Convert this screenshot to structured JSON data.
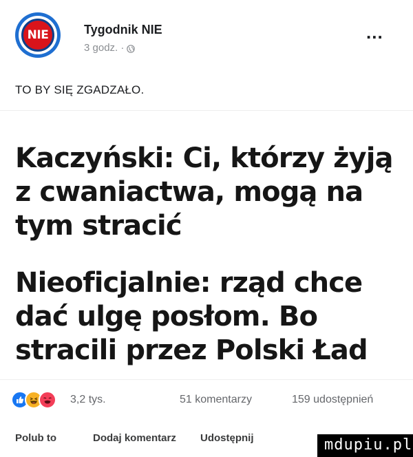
{
  "post": {
    "page_name": "Tygodnik NIE",
    "avatar_text": "NIE",
    "timestamp": "3 godz. ·",
    "text": "TO BY SIĘ ZGADZAŁO.",
    "more_label": "..."
  },
  "image": {
    "headline_1": "Kaczyński: Ci, którzy żyją z cwaniactwa, mogą na tym stracić",
    "headline_2": "Nieoficjalnie: rząd chce dać ulgę posłom. Bo stracili przez Polski Ład"
  },
  "stats": {
    "reactions_count": "3,2 tys.",
    "comments": "51 komentarzy",
    "shares": "159 udostępnień"
  },
  "actions": {
    "like": "Polub to",
    "comment": "Dodaj komentarz",
    "share": "Udostępnij"
  },
  "watermark": {
    "text": "mdupiu.pl"
  },
  "colors": {
    "like_blue": "#1877f2",
    "haha_yellow": "#f7b125",
    "wow_red": "#f33e58",
    "brand_red": "#d9141b",
    "brand_blue": "#1f6fd1"
  },
  "icons": [
    "nie-logo",
    "globe-icon",
    "more-icon",
    "like-reaction-icon",
    "haha-reaction-icon",
    "wow-reaction-icon"
  ]
}
